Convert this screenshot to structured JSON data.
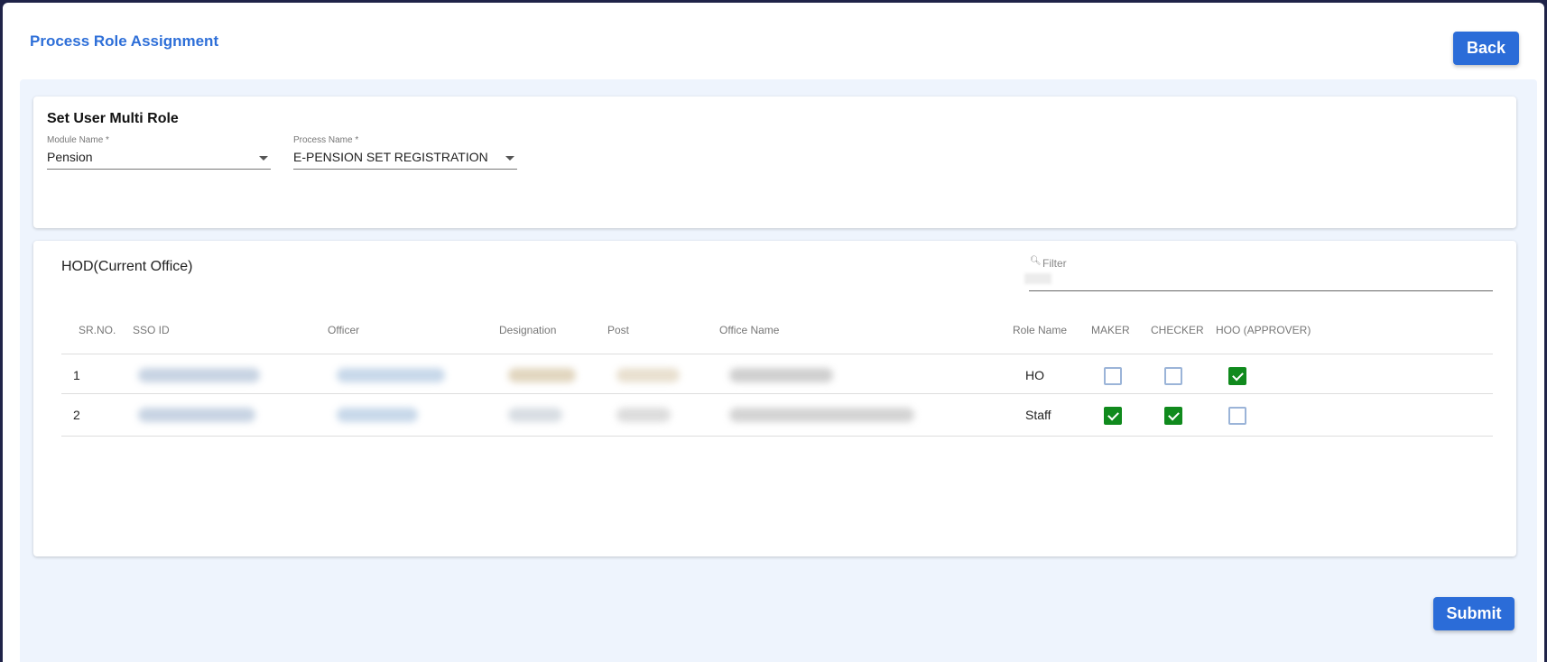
{
  "header": {
    "title": "Process Role Assignment",
    "back_label": "Back"
  },
  "role_card": {
    "title": "Set User Multi Role",
    "module": {
      "label": "Module Name *",
      "value": "Pension"
    },
    "process": {
      "label": "Process Name *",
      "value": "E-PENSION SET REGISTRATION"
    }
  },
  "hod_card": {
    "title": "HOD(Current Office)",
    "filter": {
      "label": "Filter",
      "icon": "search-icon"
    },
    "columns": [
      "SR.NO.",
      "SSO ID",
      "Officer",
      "Designation",
      "Post",
      "Office Name",
      "Role Name",
      "MAKER",
      "CHECKER",
      "HOO (APPROVER)"
    ],
    "rows": [
      {
        "sr": "1",
        "role_name": "HO",
        "maker": false,
        "checker": false,
        "hoo": true
      },
      {
        "sr": "2",
        "role_name": "Staff",
        "maker": true,
        "checker": true,
        "hoo": false
      }
    ]
  },
  "footer": {
    "submit_label": "Submit"
  },
  "colors": {
    "accent": "#2b6cd8",
    "checked": "#108a1d",
    "panel_bg": "#eef4fd"
  }
}
